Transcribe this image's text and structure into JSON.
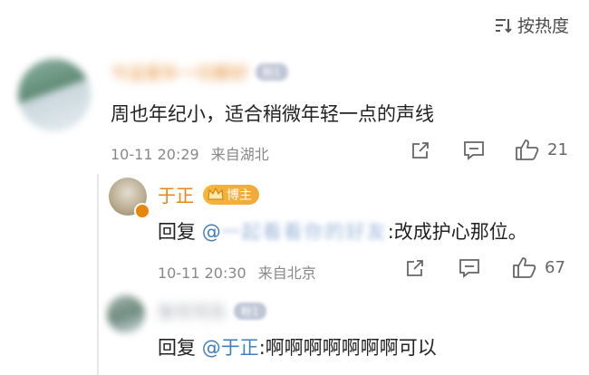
{
  "sort": {
    "label": "按热度"
  },
  "comment": {
    "user_name": "今运爱补一切都好",
    "fan_badge": "粉1",
    "text": "周也年纪小，适合稍微年轻一点的声线",
    "time": "10-11 20:29",
    "location": "来自湖北",
    "likes": "21"
  },
  "reply1": {
    "user_name": "于正",
    "role_badge": "博主",
    "reply_prefix": "回复",
    "mention": "@一起看看你的好友",
    "text": ":改成护心那位。",
    "time": "10-11 20:30",
    "location": "来自北京",
    "likes": "67"
  },
  "reply2": {
    "user_name": "张可可乐",
    "fan_badge": "粉1",
    "reply_prefix": "回复",
    "mention": "@于正",
    "text": ":啊啊啊啊啊啊啊可以"
  },
  "colors": {
    "name_orange": "#e8850c",
    "link_blue": "#3d7fc2",
    "badge_gold": "#f4b23a"
  }
}
